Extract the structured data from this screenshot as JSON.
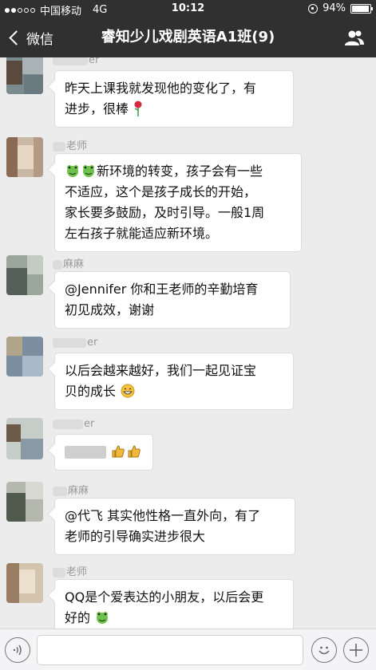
{
  "status_bar": {
    "carrier": "中国移动",
    "network": "4G",
    "time": "10:12",
    "battery": "94%",
    "battery_level": 0.94
  },
  "nav": {
    "back_label": "微信",
    "title": "睿知少儿戏剧英语A1班(9)"
  },
  "messages": [
    {
      "sender": "er",
      "lines": [
        "昨天上课我就发现他的变化了，有",
        "进步，很棒"
      ]
    },
    {
      "sender": "老师",
      "lines": [
        "新环境的转变，孩子会有一些",
        "不适应，这个是孩子成长的开始，",
        "家长要多鼓励，及时引导。一般1周",
        "左右孩子就能适应新环境。"
      ]
    },
    {
      "sender": "麻麻",
      "lines": [
        "@Jennifer 你和王老师的辛勤培育",
        "初见成效，谢谢"
      ]
    },
    {
      "sender": "er",
      "lines": [
        "以后会越来越好，我们一起见证宝",
        "贝的成长"
      ]
    },
    {
      "sender": "er",
      "lines": [
        ""
      ]
    },
    {
      "sender": "麻麻",
      "lines": [
        "@代飞 其实他性格一直外向，有了",
        "老师的引导确实进步很大"
      ]
    },
    {
      "sender": "老师",
      "lines": [
        "QQ是个爱表达的小朋友，以后会更",
        "好的"
      ]
    }
  ],
  "colors": {
    "bar": "#303030",
    "chat_bg": "#ececec",
    "emoji_green": "#6cc24a",
    "thumb_yellow": "#f2b73a"
  }
}
